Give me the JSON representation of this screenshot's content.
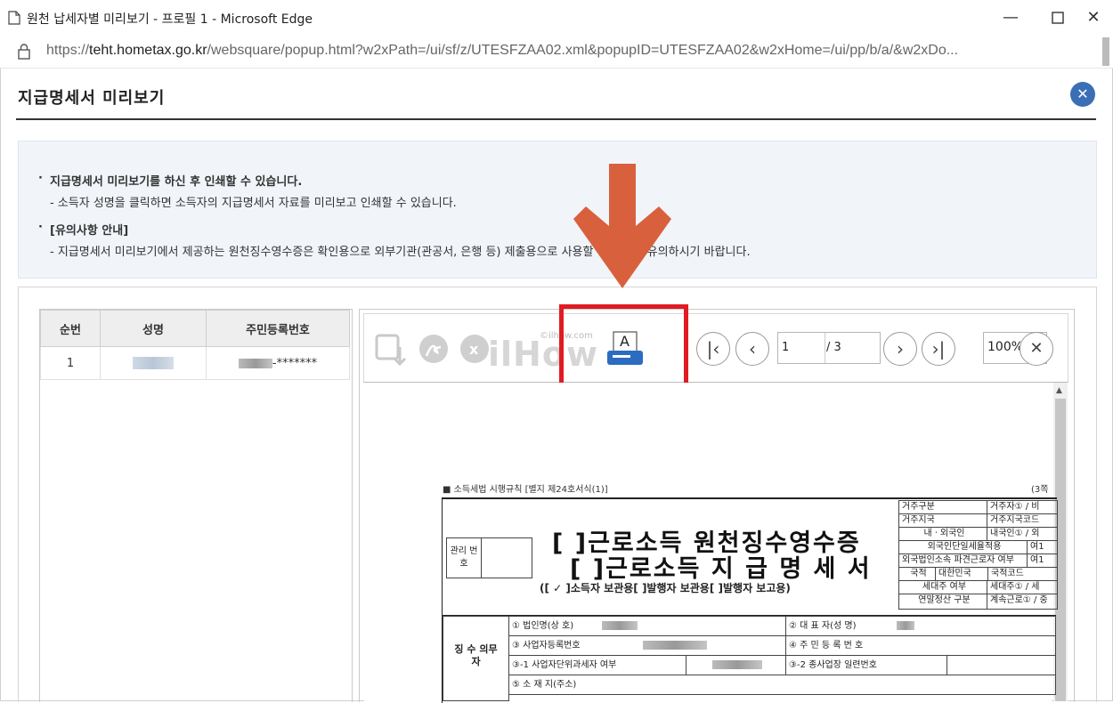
{
  "window": {
    "title": "원천 납세자별 미리보기 - 프로필 1 - Microsoft Edge",
    "url_prefix": "https://",
    "url_host": "teht.hometax.go.kr",
    "url_rest": "/websquare/popup.html?w2xPath=/ui/sf/z/UTESFZAA02.xml&popupID=UTESFZAA02&w2xHome=/ui/pp/b/a/&w2xDo..."
  },
  "popup": {
    "heading": "지급명세서 미리보기",
    "close_symbol": "✕"
  },
  "notice": {
    "line1": "지급명세서 미리보기를 하신 후 인쇄할 수 있습니다.",
    "line2": "- 소득자 성명을 클릭하면 소득자의 지급명세서 자료를 미리보고 인쇄할 수 있습니다.",
    "line3": "[유의사항 안내]",
    "line4": "- 지급명세서 미리보기에서 제공하는 원천징수영수증은 확인용으로 외부기관(관공서, 은행 등) 제출용으로 사용할 수 없으니 유의하시기 바랍니다."
  },
  "list": {
    "headers": [
      "순번",
      "성명",
      "주민등록번호"
    ],
    "rows": [
      {
        "no": "1",
        "rrn_suffix": "-*******"
      }
    ]
  },
  "viewer": {
    "page_current": "1",
    "page_total": "/ 3",
    "zoom": "100%",
    "watermark": "ilHow",
    "watermark_small": "©ilhow.com",
    "print_icon_letter": "A"
  },
  "document": {
    "header_left": "■ 소득세법 시행규칙 [별지 제24호서식(1)]",
    "header_right": "(3쪽",
    "mgmt_label": "관리 번호",
    "title1": "[  ]근로소득 원천징수영수증",
    "title2": "[  ]근로소득 지 급 명 세 서",
    "subtitle": "([ ✓ ]소득자 보관용[     ]발행자 보관용[     ]발행자 보고용)",
    "side_rows": [
      [
        "거주구분",
        "거주자① / 비"
      ],
      [
        "거주지국",
        "거주지국코드"
      ],
      [
        "내ㆍ외국인",
        "내국인① / 외"
      ],
      [
        "외국인단일세율적용",
        "여1"
      ],
      [
        "외국법인소속 파견근로자 여부",
        "여1"
      ],
      [
        "국적",
        "대한민국",
        "국적코드"
      ],
      [
        "세대주 여부",
        "세대주① / 세"
      ],
      [
        "연말정산 구분",
        "계속근로① / 중"
      ]
    ],
    "payer_label": "징 수 의무자",
    "payer_rows": [
      [
        "① 법인명(상 호)",
        "② 대 표 자(성 명)"
      ],
      [
        "③ 사업자등록번호",
        "④ 주 민 등 록 번 호"
      ],
      [
        "③-1 사업자단위과세자 여부",
        "③-2 종사업장 일련번호"
      ],
      [
        "⑤ 소 재 지(주소)"
      ]
    ]
  },
  "colors": {
    "accent": "#3a6fb6",
    "highlight": "#e11b22",
    "arrow": "#d9603c"
  }
}
